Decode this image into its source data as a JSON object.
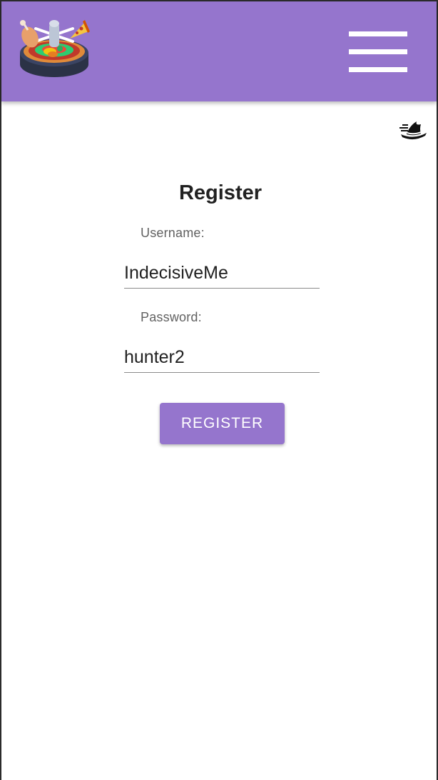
{
  "header": {
    "logo_icon": "roulette-food-wheel-icon",
    "menu_icon": "hamburger-menu-icon",
    "background_color": "#9575cd"
  },
  "theme_toggle": {
    "icon": "witch-hat-icon"
  },
  "register_form": {
    "title": "Register",
    "username": {
      "label": "Username:",
      "value": "IndecisiveMe"
    },
    "password": {
      "label": "Password:",
      "value": "hunter2"
    },
    "submit_label": "REGISTER"
  },
  "colors": {
    "accent": "#9575cd",
    "text": "#212121",
    "label": "#616161"
  }
}
